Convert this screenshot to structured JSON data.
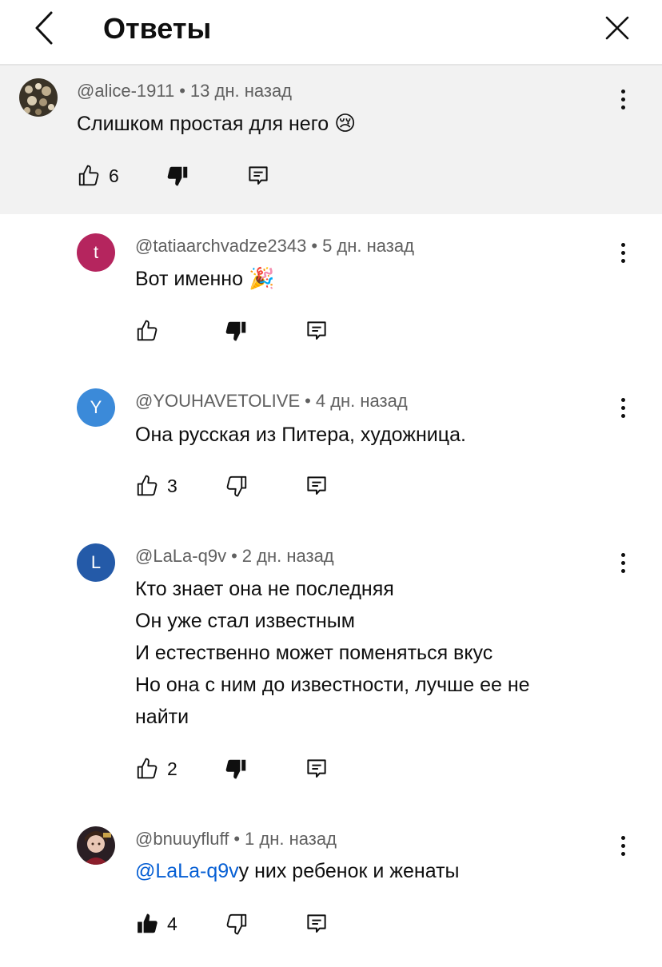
{
  "header": {
    "title": "Ответы"
  },
  "parent": {
    "author": "@alice-1911",
    "time": "13 дн. назад",
    "text": "Слишком простая для него",
    "emoji": "😢",
    "likes": "6",
    "disliked": true
  },
  "replies": [
    {
      "author": "@tatiaarchvadze2343",
      "time": "5 дн. назад",
      "avatar_letter": "t",
      "avatar_color": "#b5255e",
      "text": "Вот именно",
      "emoji": "🎉",
      "likes": "",
      "liked": false,
      "disliked": true
    },
    {
      "author": "@YOUHAVETOLIVE",
      "time": "4 дн. назад",
      "avatar_letter": "Y",
      "avatar_color": "#3b8ad9",
      "text": "Она русская из Питера, художница.",
      "likes": "3",
      "liked": false,
      "disliked": false
    },
    {
      "author": "@LaLa-q9v",
      "time": "2 дн. назад",
      "avatar_letter": "L",
      "avatar_color": "#245aa8",
      "lines": [
        "Кто знает она не последняя",
        "Он уже стал известным",
        "И естественно может поменяться вкус",
        "Но она с ним до известности, лучше ее не",
        "найти"
      ],
      "likes": "2",
      "liked": false,
      "disliked": true
    },
    {
      "author": "@bnuuyfluff",
      "time": "1 дн. назад",
      "mention": "@LaLa-q9v",
      "text": "у них ребенок и женаты",
      "likes": "4",
      "liked": true,
      "disliked": false
    }
  ],
  "colors": {
    "mention": "#065fd4",
    "parent_bg": "#f2f2f2",
    "meta": "#606060"
  }
}
